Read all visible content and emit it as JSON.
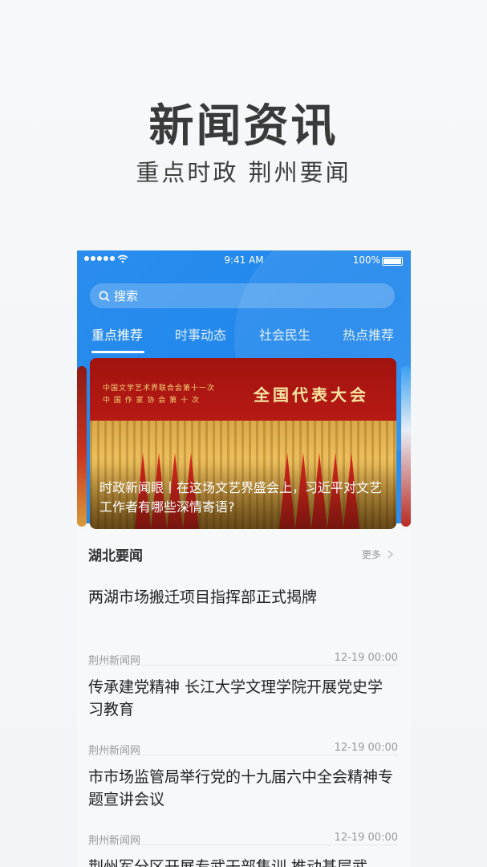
{
  "promo": {
    "title": "新闻资讯",
    "subtitle": "重点时政 荆州要闻"
  },
  "status_bar": {
    "time": "9:41 AM",
    "battery": "100%"
  },
  "search": {
    "placeholder": "搜索"
  },
  "tabs": [
    {
      "label": "重点推荐",
      "active": true
    },
    {
      "label": "时事动态",
      "active": false
    },
    {
      "label": "社会民生",
      "active": false
    },
    {
      "label": "热点推荐",
      "active": false
    }
  ],
  "banner": {
    "backdrop_line1": "中国文学艺术界联合会第十一次",
    "backdrop_line2": "中 国 作 家 协 会 第 十 次",
    "backdrop_big": "全国代表大会",
    "caption": "时政新闻眼丨在这场文艺界盛会上，习近平对文艺工作者有哪些深情寄语?"
  },
  "section": {
    "title": "湖北要闻",
    "more": "更多"
  },
  "news": [
    {
      "title": "两湖市场搬迁项目指挥部正式揭牌",
      "source": "荆州新闻网",
      "time": "12-19 00:00"
    },
    {
      "title": "传承建党精神 长江大学文理学院开展党史学习教育",
      "source": "荆州新闻网",
      "time": "12-19 00:00"
    },
    {
      "title": "市市场监管局举行党的十九届六中全会精神专题宣讲会议",
      "source": "荆州新闻网",
      "time": "12-19 00:00"
    },
    {
      "title": "荆州军分区开展专武干部集训 推动基层武",
      "source": "",
      "time": ""
    }
  ],
  "colors": {
    "brand_blue": "#1f86ec",
    "text_dark": "#222222",
    "text_meta": "#999999"
  }
}
